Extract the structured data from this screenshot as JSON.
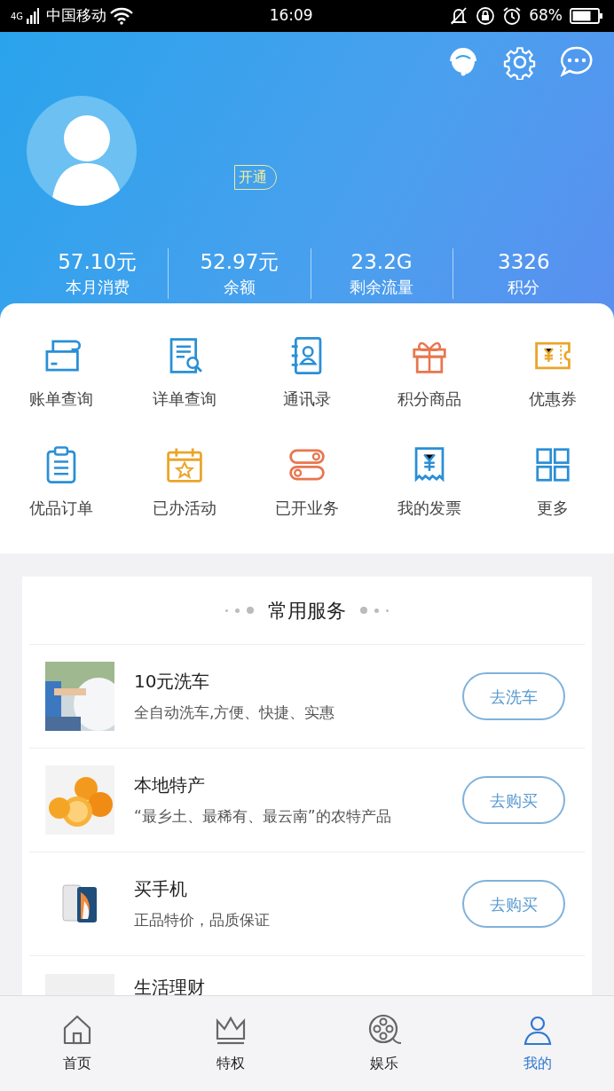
{
  "status_bar": {
    "network": "4G",
    "carrier": "中国移动",
    "time": "16:09",
    "battery": "68%"
  },
  "profile": {
    "badge": "开通"
  },
  "stats": [
    {
      "value": "57.10元",
      "label": "本月消费"
    },
    {
      "value": "52.97元",
      "label": "余额"
    },
    {
      "value": "23.2G",
      "label": "剩余流量"
    },
    {
      "value": "3326",
      "label": "积分"
    }
  ],
  "shortcuts": [
    {
      "label": "账单查询"
    },
    {
      "label": "详单查询"
    },
    {
      "label": "通讯录"
    },
    {
      "label": "积分商品"
    },
    {
      "label": "优惠券"
    },
    {
      "label": "优品订单"
    },
    {
      "label": "已办活动"
    },
    {
      "label": "已开业务"
    },
    {
      "label": "我的发票"
    },
    {
      "label": "更多"
    }
  ],
  "services": {
    "title": "常用服务",
    "items": [
      {
        "title": "10元洗车",
        "subtitle": "全自动洗车,方便、快捷、实惠",
        "button": "去洗车",
        "kind": "picture"
      },
      {
        "title": "本地特产",
        "subtitle": "“最乡土、最稀有、最云南”的农特产品",
        "button": "去购买",
        "kind": "picture"
      },
      {
        "title": "买手机",
        "subtitle": "正品特价，品质保证",
        "button": "去购买",
        "kind": "picture"
      },
      {
        "title": "生活理财",
        "kind": "picture"
      }
    ]
  },
  "tab_bar": [
    {
      "label": "首页",
      "selected": false
    },
    {
      "label": "特权",
      "selected": false
    },
    {
      "label": "娱乐",
      "selected": false
    },
    {
      "label": "我的",
      "selected": true
    }
  ]
}
